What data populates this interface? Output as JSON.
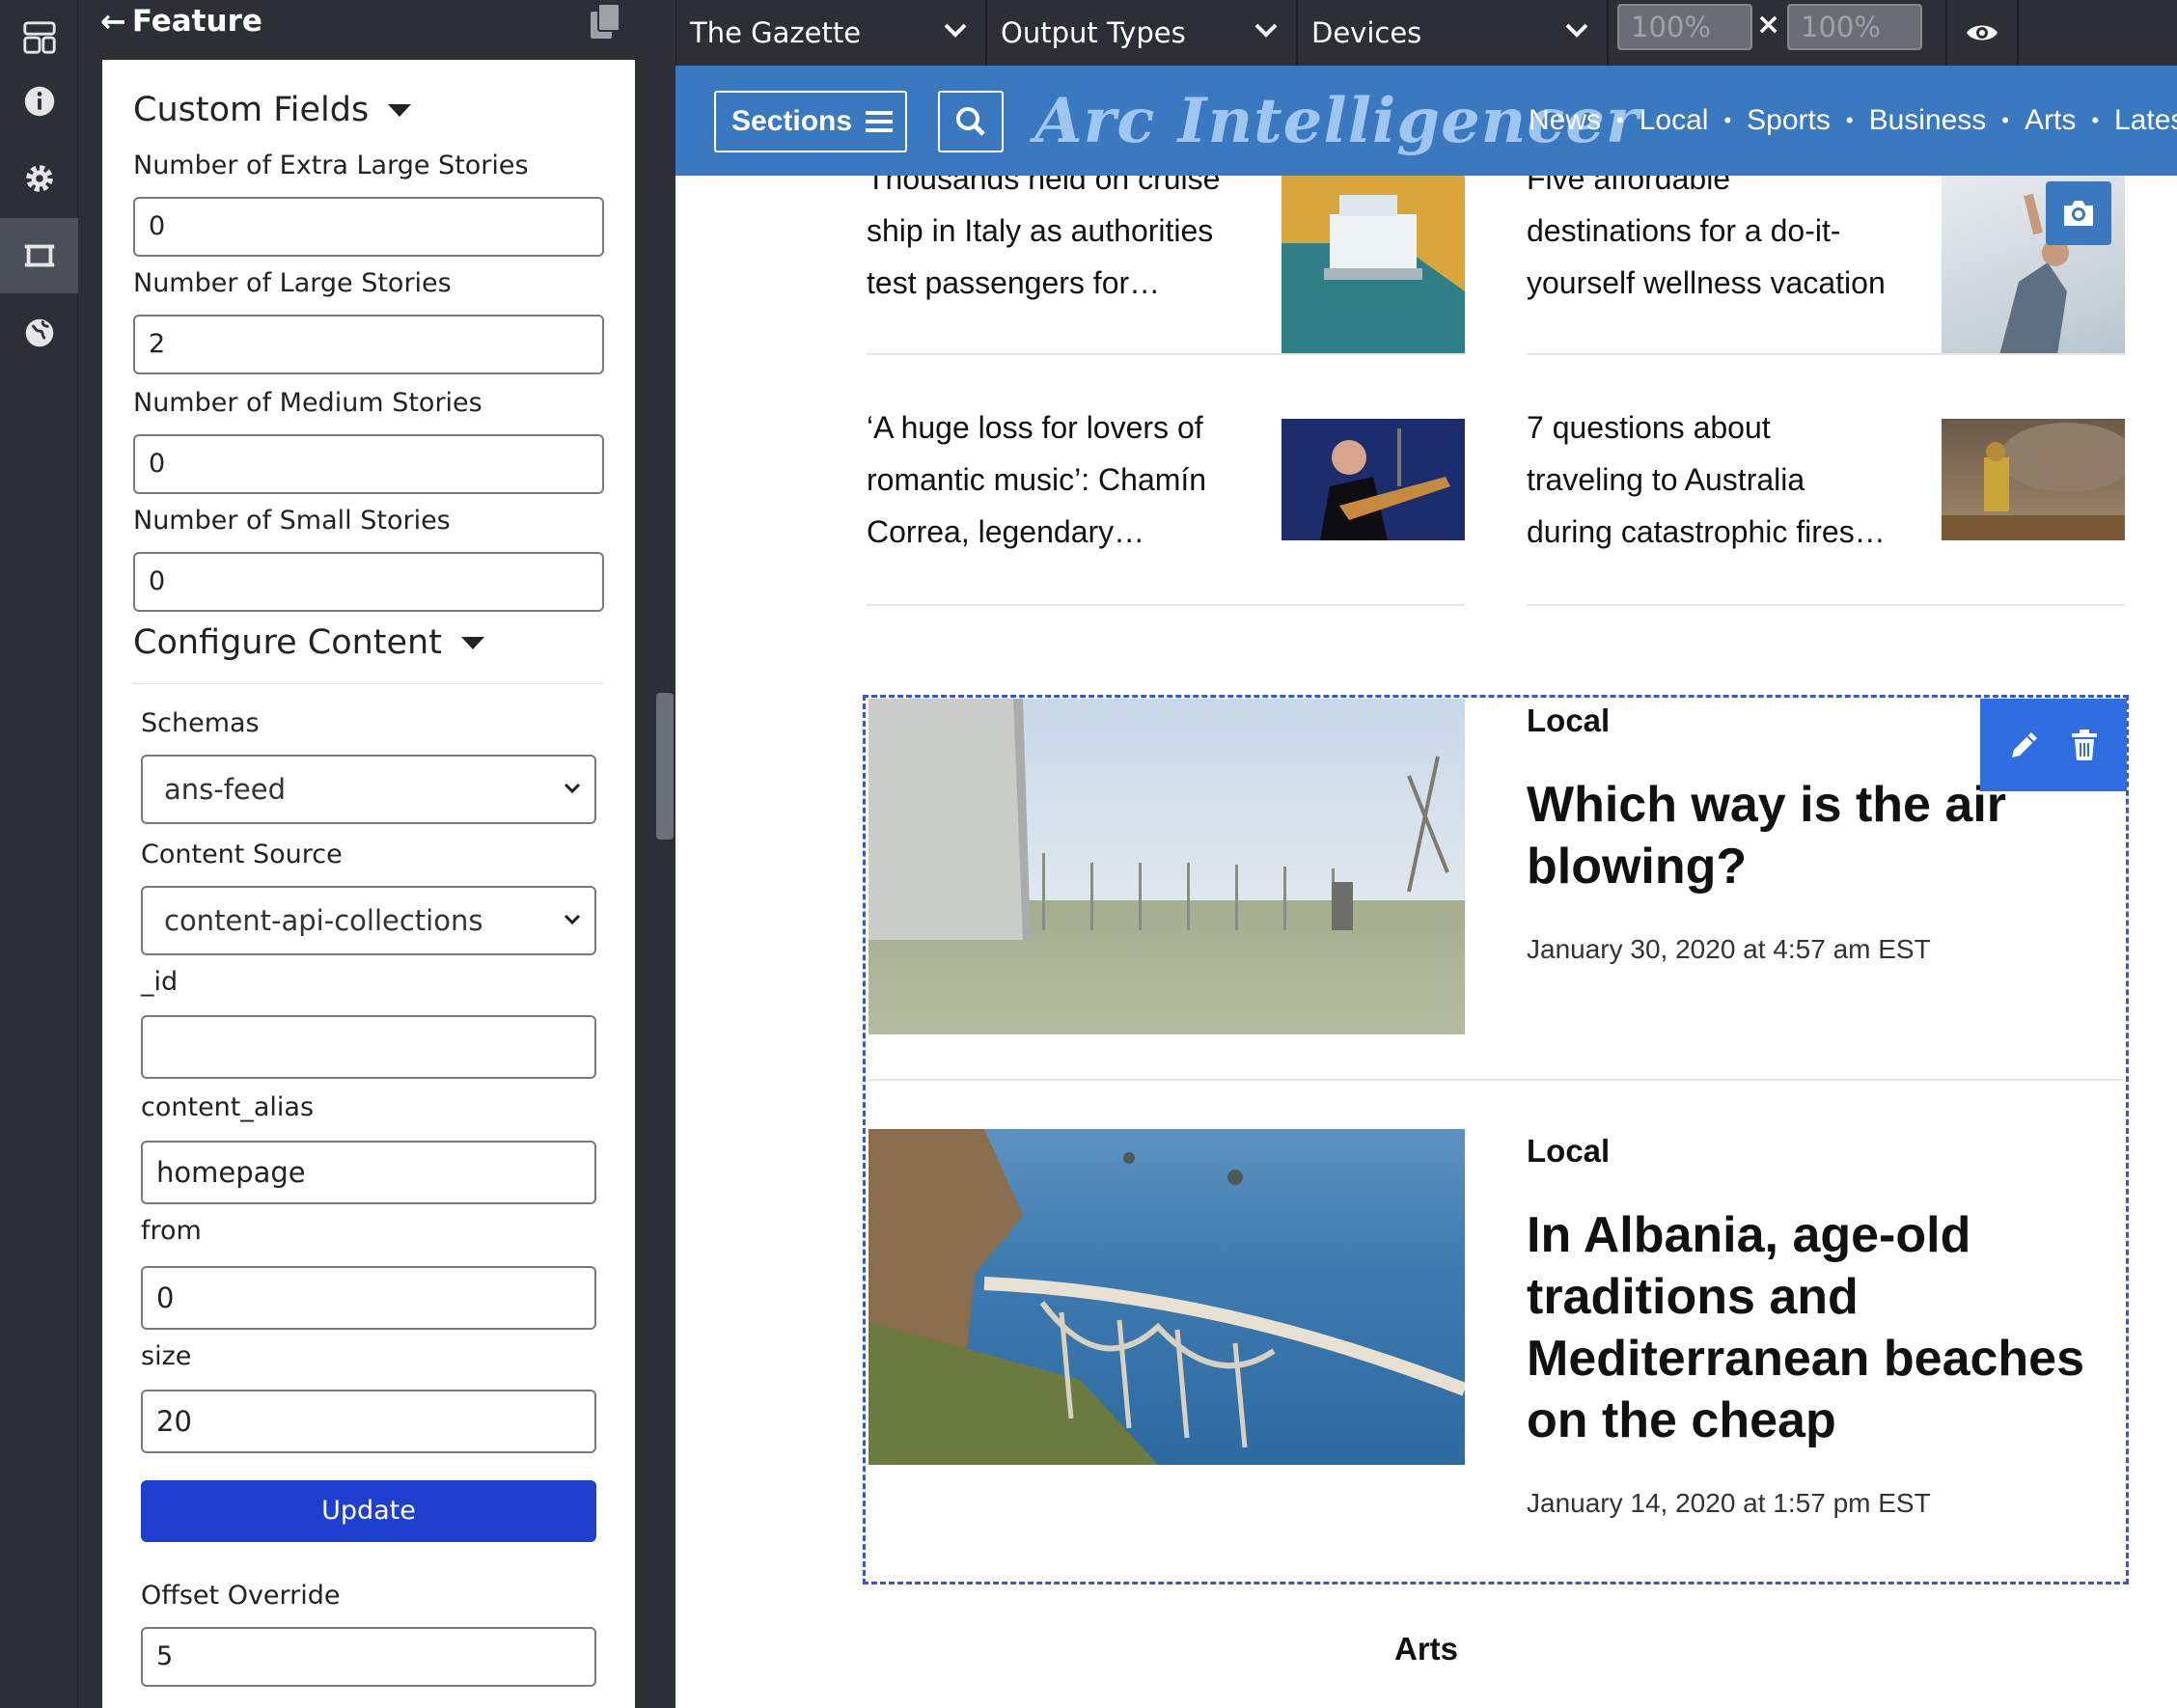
{
  "rail": {
    "items": [
      {
        "icon": "layout-icon"
      },
      {
        "icon": "info-icon"
      },
      {
        "icon": "gear-icon"
      },
      {
        "icon": "feature-frame-icon",
        "active": true
      },
      {
        "icon": "globe-icon"
      }
    ]
  },
  "panel": {
    "title": "Feature",
    "back_icon": "arrow-left-icon",
    "copy_icon": "copy-icon",
    "custom_fields": {
      "heading": "Custom Fields",
      "fields": [
        {
          "label": "Number of Extra Large Stories",
          "value": "0"
        },
        {
          "label": "Number of Large Stories",
          "value": "2"
        },
        {
          "label": "Number of Medium Stories",
          "value": "0"
        },
        {
          "label": "Number of Small Stories",
          "value": "0"
        }
      ]
    },
    "configure_content": {
      "heading": "Configure Content",
      "schemas_label": "Schemas",
      "schemas_value": "ans-feed",
      "source_label": "Content Source",
      "source_value": "content-api-collections",
      "id_label": "_id",
      "id_value": "",
      "alias_label": "content_alias",
      "alias_value": "homepage",
      "from_label": "from",
      "from_value": "0",
      "size_label": "size",
      "size_value": "20",
      "update_label": "Update",
      "offset_label": "Offset Override",
      "offset_value": "5"
    }
  },
  "toolbar": {
    "site": "The Gazette",
    "output_types": "Output Types",
    "devices": "Devices",
    "width": "100%",
    "height": "100%",
    "times": "×",
    "preview_icon": "eye-icon"
  },
  "site": {
    "sections_label": "Sections",
    "masthead": "Arc Intelligencer",
    "nav": [
      "News",
      "Local",
      "Sports",
      "Business",
      "Arts",
      "Latest"
    ],
    "colors": {
      "nav_bg": "#3a78c0",
      "accent": "#2f6ee0"
    }
  },
  "stories": [
    {
      "lines": [
        "Thousands held on cruise",
        "ship in Italy as authorities",
        "test passengers for…"
      ]
    },
    {
      "lines": [
        "Five affordable",
        "destinations for a do-it-",
        "yourself wellness vacation"
      ]
    },
    {
      "lines": [
        "‘A huge loss for lovers of",
        "romantic music’: Chamín",
        "Correa, legendary…"
      ]
    },
    {
      "lines": [
        "7 questions about",
        "traveling to Australia",
        "during catastrophic fires…"
      ]
    }
  ],
  "featured": [
    {
      "kicker": "Local",
      "headline_lines": [
        "Which way is the air",
        "blowing?"
      ],
      "date": "January 30, 2020 at 4:57 am EST"
    },
    {
      "kicker": "Local",
      "headline_lines": [
        "In Albania, age-old",
        "traditions and",
        "Mediterranean beaches",
        "on the cheap"
      ],
      "date": "January 14, 2020 at 1:57 pm EST"
    }
  ],
  "next_section": "Arts"
}
